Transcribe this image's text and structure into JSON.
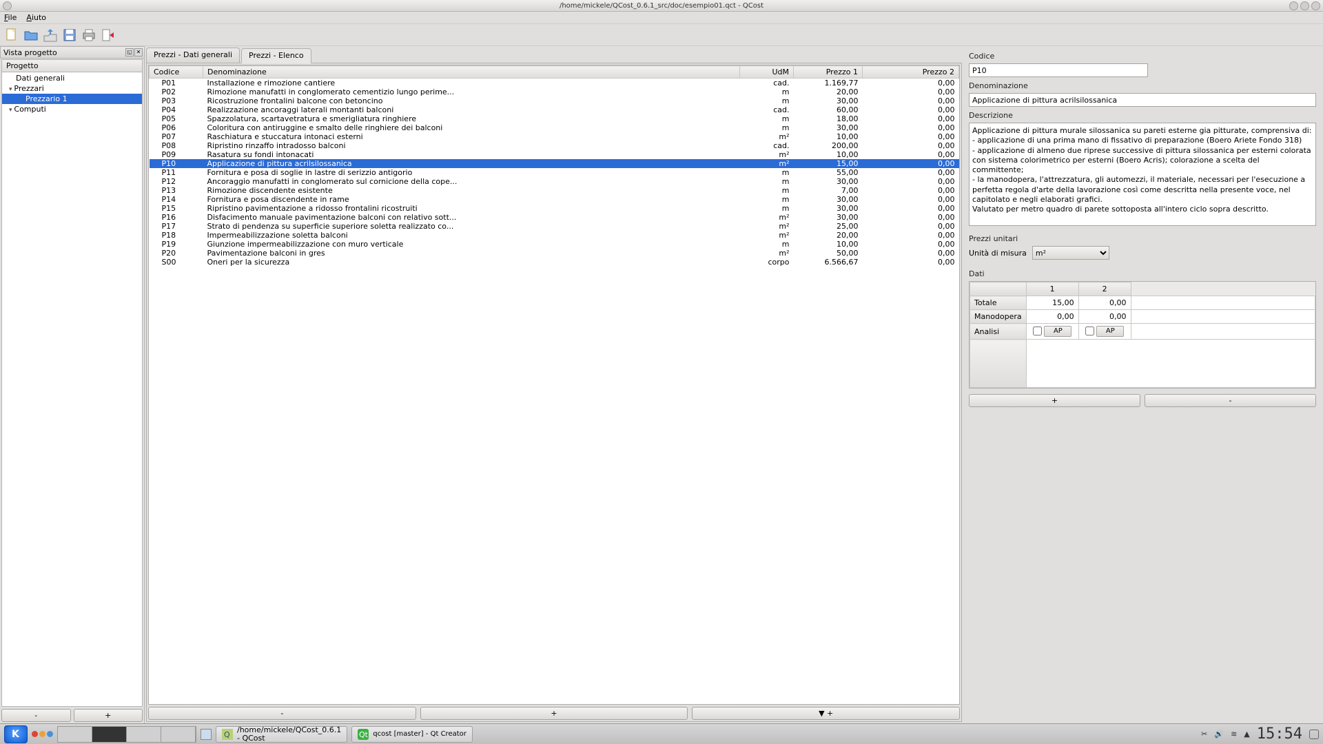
{
  "window": {
    "title": "/home/mickele/QCost_0.6.1_src/doc/esempio01.qct - QCost"
  },
  "menu": {
    "file": "File",
    "aiuto": "Aiuto"
  },
  "dock": {
    "title": "Vista progetto",
    "tree_header": "Progetto",
    "items": {
      "dati": "Dati generali",
      "prezzari": "Prezzari",
      "prezzario1": "Prezzario 1",
      "computi": "Computi"
    }
  },
  "left_btns": {
    "minus": "-",
    "plus": "+"
  },
  "tabs": {
    "dati": "Prezzi - Dati generali",
    "elenco": "Prezzi - Elenco"
  },
  "columns": {
    "codice": "Codice",
    "denom": "Denominazione",
    "udm": "UdM",
    "p1": "Prezzo 1",
    "p2": "Prezzo 2"
  },
  "rows": [
    {
      "c": "P01",
      "d": "Installazione e rimozione cantiere",
      "u": "cad.",
      "p1": "1.169,77",
      "p2": "0,00"
    },
    {
      "c": "P02",
      "d": "Rimozione manufatti in conglomerato cementizio lungo perime...",
      "u": "m",
      "p1": "20,00",
      "p2": "0,00"
    },
    {
      "c": "P03",
      "d": "Ricostruzione frontalini balcone con betoncino",
      "u": "m",
      "p1": "30,00",
      "p2": "0,00"
    },
    {
      "c": "P04",
      "d": "Realizzazione ancoraggi laterali montanti balconi",
      "u": "cad.",
      "p1": "60,00",
      "p2": "0,00"
    },
    {
      "c": "P05",
      "d": "Spazzolatura, scartavetratura e smerigliatura ringhiere",
      "u": "m",
      "p1": "18,00",
      "p2": "0,00"
    },
    {
      "c": "P06",
      "d": "Coloritura con antiruggine e smalto delle ringhiere dei balconi",
      "u": "m",
      "p1": "30,00",
      "p2": "0,00"
    },
    {
      "c": "P07",
      "d": "Raschiatura e stuccatura intonaci esterni",
      "u": "m²",
      "p1": "10,00",
      "p2": "0,00"
    },
    {
      "c": "P08",
      "d": "Ripristino rinzaffo intradosso balconi",
      "u": "cad.",
      "p1": "200,00",
      "p2": "0,00"
    },
    {
      "c": "P09",
      "d": "Rasatura su fondi intonacati",
      "u": "m²",
      "p1": "10,00",
      "p2": "0,00"
    },
    {
      "c": "P10",
      "d": "Applicazione di pittura acrilsilossanica",
      "u": "m²",
      "p1": "15,00",
      "p2": "0,00"
    },
    {
      "c": "P11",
      "d": "Fornitura e posa di soglie in lastre di serizzio antigorio",
      "u": "m",
      "p1": "55,00",
      "p2": "0,00"
    },
    {
      "c": "P12",
      "d": "Ancoraggio manufatti in conglomerato sul cornicione della cope...",
      "u": "m",
      "p1": "30,00",
      "p2": "0,00"
    },
    {
      "c": "P13",
      "d": "Rimozione discendente esistente",
      "u": "m",
      "p1": "7,00",
      "p2": "0,00"
    },
    {
      "c": "P14",
      "d": "Fornitura e posa discendente in rame",
      "u": "m",
      "p1": "30,00",
      "p2": "0,00"
    },
    {
      "c": "P15",
      "d": "Ripristino pavimentazione a ridosso frontalini ricostruiti",
      "u": "m",
      "p1": "30,00",
      "p2": "0,00"
    },
    {
      "c": "P16",
      "d": "Disfacimento manuale pavimentazione balconi con relativo sott...",
      "u": "m²",
      "p1": "30,00",
      "p2": "0,00"
    },
    {
      "c": "P17",
      "d": "Strato di pendenza su superficie superiore soletta realizzato co...",
      "u": "m²",
      "p1": "25,00",
      "p2": "0,00"
    },
    {
      "c": "P18",
      "d": "Impermeabilizzazione soletta balconi",
      "u": "m²",
      "p1": "20,00",
      "p2": "0,00"
    },
    {
      "c": "P19",
      "d": "Giunzione impermeabilizzazione con muro verticale",
      "u": "m",
      "p1": "10,00",
      "p2": "0,00"
    },
    {
      "c": "P20",
      "d": "Pavimentazione balconi in gres",
      "u": "m²",
      "p1": "50,00",
      "p2": "0,00"
    },
    {
      "c": "S00",
      "d": "Oneri per la sicurezza",
      "u": "corpo",
      "p1": "6.566,67",
      "p2": "0,00"
    }
  ],
  "center_btns": {
    "minus": "-",
    "plus": "+",
    "down_plus": "▼ +"
  },
  "detail": {
    "lbl_codice": "Codice",
    "codice": "P10",
    "lbl_denom": "Denominazione",
    "denom": "Applicazione di pittura acrilsilossanica",
    "lbl_desc": "Descrizione",
    "desc": "Applicazione di pittura murale silossanica su pareti esterne gia pitturate, comprensiva di:\n- applicazione di una prima mano di fissativo di preparazione (Boero Ariete Fondo 318)\n- applicazione di almeno due riprese successive di pittura silossanica per esterni colorata con sistema colorimetrico per esterni (Boero Acris); colorazione a scelta del committente;\n- la manodopera, l'attrezzatura, gli automezzi, il materiale, necessari per l'esecuzione a perfetta regola d'arte della lavorazione così come descritta nella presente voce, nel capitolato e negli elaborati grafici.\nValutato per metro quadro di parete sottoposta all'intero ciclo sopra descritto.",
    "lbl_prezzi": "Prezzi unitari",
    "lbl_udm": "Unità di misura",
    "udm_val": "m²",
    "lbl_dati": "Dati",
    "col1": "1",
    "col2": "2",
    "row_totale": "Totale",
    "totale1": "15,00",
    "totale2": "0,00",
    "row_mano": "Manodopera",
    "mano1": "0,00",
    "mano2": "0,00",
    "row_analisi": "Analisi",
    "ap": "AP",
    "plus": "+",
    "minus": "-"
  },
  "taskbar": {
    "task1_line1": "/home/mickele/QCost_0.6.1",
    "task1_line2": "- QCost",
    "task2": "qcost [master] - Qt Creator",
    "clock": "15:54"
  }
}
